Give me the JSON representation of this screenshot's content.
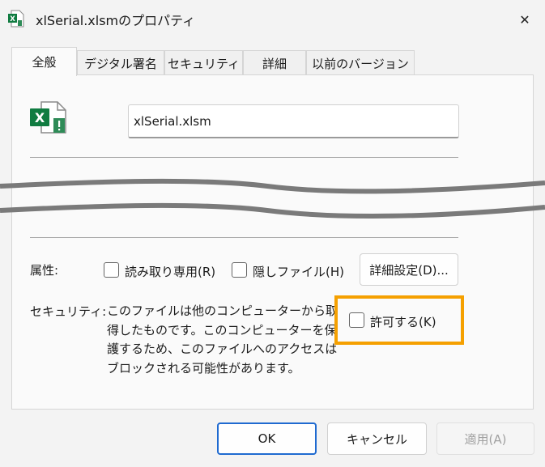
{
  "window": {
    "title": "xlSerial.xlsmのプロパティ",
    "close_glyph": "✕"
  },
  "tabs": [
    {
      "label": "全般"
    },
    {
      "label": "デジタル署名"
    },
    {
      "label": "セキュリティ"
    },
    {
      "label": "詳細"
    },
    {
      "label": "以前のバージョン"
    }
  ],
  "general": {
    "file_name": "xlSerial.xlsm",
    "file_icon": "excel-macro-file-icon",
    "attributes_label": "属性:",
    "readonly_label": "読み取り専用(R)",
    "readonly_checked": false,
    "hidden_label": "隠しファイル(H)",
    "hidden_checked": false,
    "advanced_button": "詳細設定(D)...",
    "security_label": "セキュリティ:",
    "security_message": "このファイルは他のコンピューターから取得したものです。このコンピューターを保護するため、このファイルへのアクセスはブロックされる可能性があります。",
    "unblock_label": "許可する(K)",
    "unblock_checked": false
  },
  "footer": {
    "ok": "OK",
    "cancel": "キャンセル",
    "apply": "適用(A)"
  },
  "colors": {
    "highlight": "#f5a000",
    "excel_green": "#107c41",
    "primary_border": "#1f6ad0"
  }
}
